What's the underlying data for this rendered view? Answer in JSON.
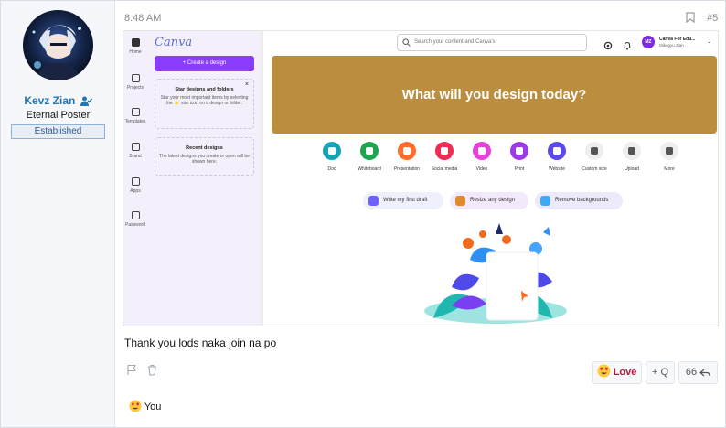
{
  "user": {
    "name": "Kevz Zian",
    "title": "Eternal Poster",
    "badge": "Established"
  },
  "post": {
    "time": "8:48 AM",
    "number": "#5",
    "text": "Thank you lods naka join na po"
  },
  "screenshot": {
    "logo": "Canva",
    "rail": [
      "Home",
      "Projects",
      "Templates",
      "Brand",
      "Apps",
      "Password"
    ],
    "create_button": "+ Create a design",
    "star_box": {
      "title": "Star designs and folders",
      "body": "Star your most important items by selecting the ⭐ star icon on a design or folder.",
      "close": "×"
    },
    "recent_box": {
      "title": "Recent designs",
      "body": "The latest designs you create or open will be shown here."
    },
    "search_placeholder": "Search your content and Canva's",
    "account": {
      "initials": "MZ",
      "name": "Canva For Edu...",
      "sub": "Mikogyu Zian"
    },
    "hero": "What will you design today?",
    "categories": [
      {
        "label": "Doc",
        "color": "#13a3b5"
      },
      {
        "label": "Whiteboard",
        "color": "#1ea34f"
      },
      {
        "label": "Presentation",
        "color": "#ff6c2c"
      },
      {
        "label": "Social media",
        "color": "#ee2c54"
      },
      {
        "label": "Video",
        "color": "#e641d8"
      },
      {
        "label": "Print",
        "color": "#9d3ce6"
      },
      {
        "label": "Website",
        "color": "#5b49e8"
      },
      {
        "label": "Custom size",
        "color": "#eeeeee"
      },
      {
        "label": "Upload",
        "color": "#eeeeee"
      },
      {
        "label": "More",
        "color": "#eeeeee"
      }
    ],
    "pills": [
      {
        "label": "Write my first draft",
        "color": "#eef0fb"
      },
      {
        "label": "Resize any design",
        "color": "#f2e9fb"
      },
      {
        "label": "Remove backgrounds",
        "color": "#eceafb"
      }
    ]
  },
  "actions": {
    "love_label": "Love",
    "quote_label": "+ Q",
    "reply_label": "66"
  },
  "reactions": {
    "summary": "You"
  }
}
